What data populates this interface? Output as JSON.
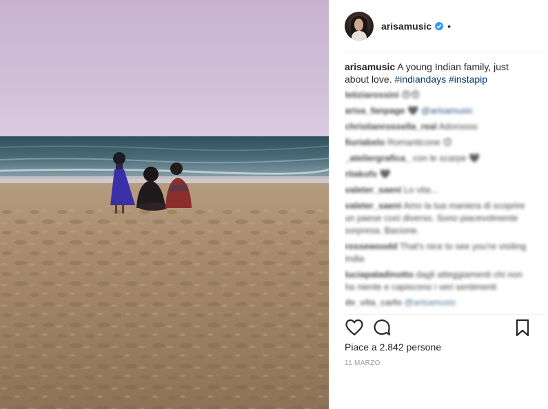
{
  "post": {
    "image_alt": "A young Indian family sitting on the beach at dusk"
  },
  "header": {
    "username": "arisamusic",
    "verified_icon": "verified-badge-icon",
    "separator": "•",
    "accent": "#3897f0"
  },
  "caption": {
    "username": "arisamusic",
    "text": "A young Indian family, just about love. ",
    "hashtags": [
      "#indiandays",
      "#instapip"
    ],
    "hashtag_color": "#003569"
  },
  "comments": [
    {
      "user": "letiziarossini",
      "text": "😍😍"
    },
    {
      "user": "arisa_fanpage",
      "text": "🖤",
      "mention": "@arisamusic"
    },
    {
      "user": "christianrossella_real",
      "text": "Adoroooo"
    },
    {
      "user": "fiuriabelo",
      "text": "Romanticone 😊"
    },
    {
      "user": "_ateliergrafica_",
      "text": "con le scarpe 🖤"
    },
    {
      "user": "ritakofs",
      "text": "🖤"
    },
    {
      "user": "valeter_saeni",
      "text": "Lo vita..."
    },
    {
      "user": "valeter_saeni",
      "text": "Amo la tua maniera di scoprire un paese così diverso. Sono piacevolmente sorpresa. Bacione."
    },
    {
      "user": "rossewoodd",
      "text": "That's nice to see you're visiting India"
    },
    {
      "user": "luciapaladinotto",
      "text": "dagli atteggiamenti chi non ha niente e capiscono i veri sentimenti"
    },
    {
      "user": "de_vita_carlo",
      "text": "",
      "mention": "@arisamusic"
    }
  ],
  "actions": {
    "like_icon": "heart-icon",
    "comment_icon": "comment-bubble-icon",
    "save_icon": "bookmark-icon"
  },
  "likes_text": "Piace a 2.842 persone",
  "date_text": "11 MARZO"
}
